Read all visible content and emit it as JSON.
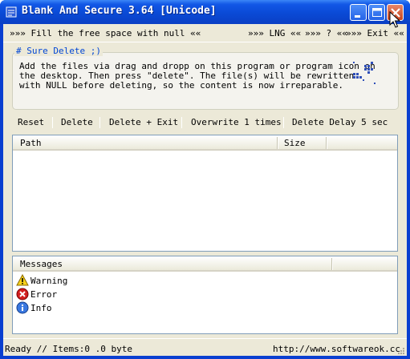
{
  "window": {
    "title": "Blank And Secure 3.64 [Unicode]"
  },
  "menu": {
    "fill": "»»» Fill the free space with null ««",
    "lng": "»»» LNG ««",
    "help": "»»» ? ««",
    "exit": "»»» Exit ««"
  },
  "info": {
    "title": "# Sure Delete ;)",
    "lines": [
      "Add the files via drag and dropp on this program or program icon on",
      "the desktop. Then press \"delete\". The file(s) will be rewritten",
      "with NULL before deleting, so the content is now irreparable."
    ]
  },
  "toolbar": {
    "reset": "Reset",
    "delete": "Delete",
    "delete_exit": "Delete + Exit",
    "overwrite": "Overwrite 1 times",
    "delay": "Delete Delay 5 sec"
  },
  "files": {
    "columns": [
      "Path",
      "Size"
    ],
    "rows": []
  },
  "messages": {
    "header": "Messages",
    "items": [
      {
        "label": "Warning",
        "icon": "warning-icon"
      },
      {
        "label": "Error",
        "icon": "error-icon"
      },
      {
        "label": "Info",
        "icon": "info-icon"
      }
    ]
  },
  "status": {
    "left": "Ready // Items:0 .0 byte",
    "right": "http://www.softwareok.cc"
  },
  "colors": {
    "title_bar": "#0a4ad6",
    "group_title": "#0046d5",
    "dialog_bg": "#ece9d8"
  }
}
